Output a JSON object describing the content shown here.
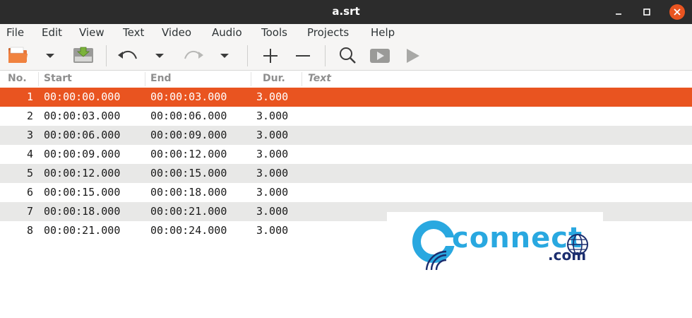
{
  "window": {
    "title": "a.srt"
  },
  "menubar": {
    "items": [
      "File",
      "Edit",
      "View",
      "Text",
      "Video",
      "Audio",
      "Tools",
      "Projects",
      "Help"
    ]
  },
  "toolbar": {
    "icons": [
      "open-folder-icon",
      "dropdown-arrow-icon",
      "save-icon",
      "undo-icon",
      "dropdown-arrow-icon",
      "redo-icon",
      "dropdown-arrow-icon",
      "add-icon",
      "remove-icon",
      "search-icon",
      "play-video-icon",
      "play-icon"
    ]
  },
  "table": {
    "columns": [
      "No.",
      "Start",
      "End",
      "Dur.",
      "Text"
    ],
    "selected_row": 0,
    "rows": [
      {
        "no": "1",
        "start": "00:00:00.000",
        "end": "00:00:03.000",
        "dur": "3.000",
        "text": ""
      },
      {
        "no": "2",
        "start": "00:00:03.000",
        "end": "00:00:06.000",
        "dur": "3.000",
        "text": ""
      },
      {
        "no": "3",
        "start": "00:00:06.000",
        "end": "00:00:09.000",
        "dur": "3.000",
        "text": ""
      },
      {
        "no": "4",
        "start": "00:00:09.000",
        "end": "00:00:12.000",
        "dur": "3.000",
        "text": ""
      },
      {
        "no": "5",
        "start": "00:00:12.000",
        "end": "00:00:15.000",
        "dur": "3.000",
        "text": ""
      },
      {
        "no": "6",
        "start": "00:00:15.000",
        "end": "00:00:18.000",
        "dur": "3.000",
        "text": ""
      },
      {
        "no": "7",
        "start": "00:00:18.000",
        "end": "00:00:21.000",
        "dur": "3.000",
        "text": ""
      },
      {
        "no": "8",
        "start": "00:00:21.000",
        "end": "00:00:24.000",
        "dur": "3.000",
        "text": ""
      }
    ]
  },
  "watermark": {
    "text": "connect",
    "suffix": ".com"
  },
  "colors": {
    "accent": "#e95420",
    "titlebar": "#2c2c2c",
    "alt_row": "#e8e8e7",
    "watermark_blue": "#29a8e0",
    "watermark_navy": "#1b2d6e"
  }
}
